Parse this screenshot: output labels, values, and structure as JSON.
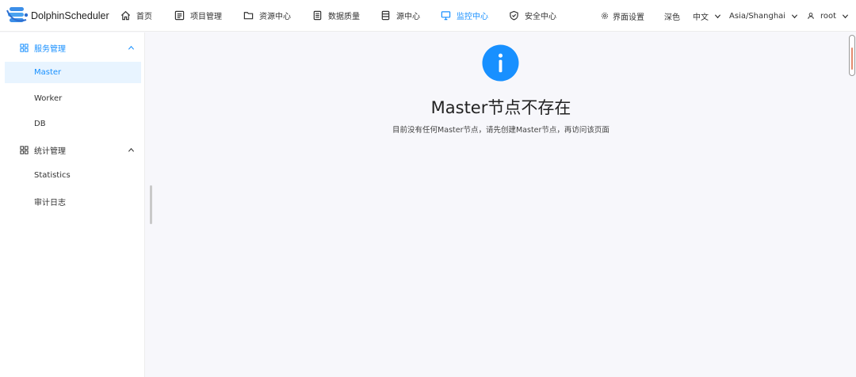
{
  "app": {
    "name": "DolphinScheduler",
    "colors": {
      "accent": "#1890ff",
      "active_bg": "#e8f4ff"
    }
  },
  "nav": [
    {
      "label": "首页",
      "icon": "home-icon"
    },
    {
      "label": "项目管理",
      "icon": "project-icon"
    },
    {
      "label": "资源中心",
      "icon": "folder-icon"
    },
    {
      "label": "数据质量",
      "icon": "document-icon"
    },
    {
      "label": "源中心",
      "icon": "datasource-icon"
    },
    {
      "label": "监控中心",
      "icon": "monitor-icon",
      "active": true
    },
    {
      "label": "安全中心",
      "icon": "shield-icon"
    }
  ],
  "header_right": {
    "settings": "界面设置",
    "theme": "深色",
    "language": "中文",
    "timezone": "Asia/Shanghai",
    "user": "root"
  },
  "sidebar": {
    "groups": [
      {
        "label": "服务管理",
        "expanded": true,
        "items": [
          {
            "label": "Master",
            "active": true
          },
          {
            "label": "Worker"
          },
          {
            "label": "DB"
          }
        ]
      },
      {
        "label": "统计管理",
        "expanded": true,
        "items": [
          {
            "label": "Statistics"
          },
          {
            "label": "审计日志"
          }
        ]
      }
    ]
  },
  "main": {
    "icon": "info-icon",
    "title": "Master节点不存在",
    "description": "目前没有任何Master节点，请先创建Master节点，再访问该页面"
  }
}
